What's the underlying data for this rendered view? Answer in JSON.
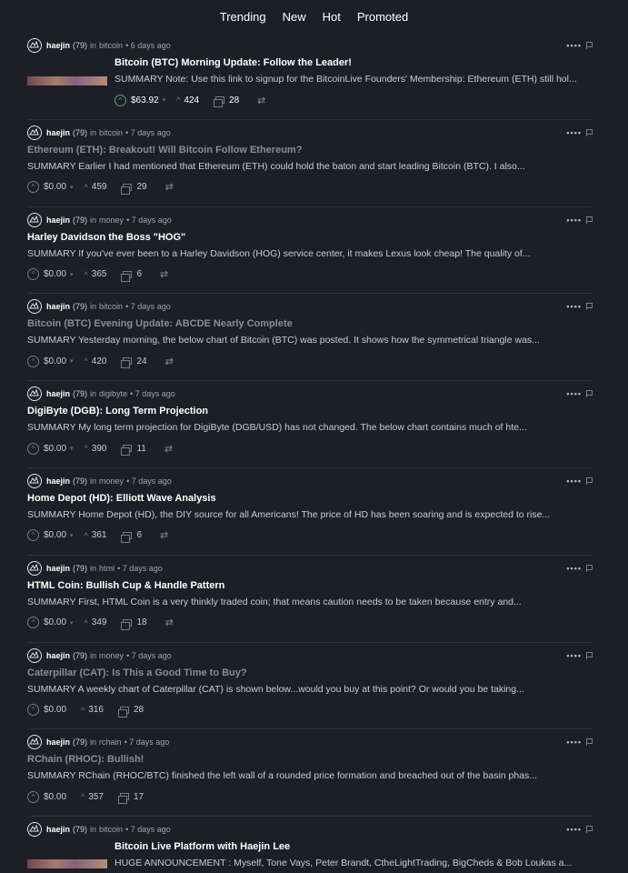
{
  "nav": {
    "tabs": [
      "Trending",
      "New",
      "Hot",
      "Promoted"
    ]
  },
  "posts": [
    {
      "author": "haejin",
      "rep": "(79)",
      "in": "in",
      "category": "bitcoin",
      "age": "• 6 days ago",
      "title": "Bitcoin (BTC) Morning Update: Follow the Leader!",
      "summary": "SUMMARY Note: Use this link to signup for the BitcoinLive Founders' Membership: Ethereum (ETH) still hol...",
      "payout": "$63.92",
      "votes": "424",
      "comments": "28",
      "muted_title": false
    },
    {
      "author": "haejin",
      "rep": "(79)",
      "in": "in",
      "category": "bitcoin",
      "age": "• 7 days ago",
      "title": "Ethereum (ETH): Breakout! Will Bitcoin Follow Ethereum?",
      "summary": "SUMMARY Earlier I had mentioned that Ethereum (ETH) could hold the baton and start leading Bitcoin (BTC). I also...",
      "payout": "$0.00",
      "votes": "459",
      "comments": "29",
      "muted_title": true
    },
    {
      "author": "haejin",
      "rep": "(79)",
      "in": "in",
      "category": "money",
      "age": "• 7 days ago",
      "title": "Harley Davidson the Boss \"HOG\"",
      "summary": "SUMMARY If you've ever been to a Harley Davidson (HOG) service center, it makes Lexus look cheap! The quality of...",
      "payout": "$0.00",
      "votes": "365",
      "comments": "6",
      "muted_title": false
    },
    {
      "author": "haejin",
      "rep": "(79)",
      "in": "in",
      "category": "bitcoin",
      "age": "• 7 days ago",
      "title": "Bitcoin (BTC) Evening Update: ABCDE Nearly Complete",
      "summary": "SUMMARY Yesterday morning, the below chart of Bitcoin (BTC) was posted. It shows how the symmetrical triangle was...",
      "payout": "$0.00",
      "votes": "420",
      "comments": "24",
      "muted_title": true
    },
    {
      "author": "haejin",
      "rep": "(79)",
      "in": "in",
      "category": "digibyte",
      "age": "• 7 days ago",
      "title": "DigiByte (DGB): Long Term Projection",
      "summary": "SUMMARY My long term projection for DigiByte (DGB/USD) has not changed. The below chart contains much of hte...",
      "payout": "$0.00",
      "votes": "390",
      "comments": "11",
      "muted_title": false
    },
    {
      "author": "haejin",
      "rep": "(79)",
      "in": "in",
      "category": "money",
      "age": "• 7 days ago",
      "title": "Home Depot (HD): Elliott Wave Analysis",
      "summary": "SUMMARY Home Depot (HD), the DIY source for all Americans! The price of HD has been soaring and is expected to rise...",
      "payout": "$0.00",
      "votes": "361",
      "comments": "6",
      "muted_title": false
    },
    {
      "author": "haejin",
      "rep": "(79)",
      "in": "in",
      "category": "html",
      "age": "• 7 days ago",
      "title": "HTML Coin: Bullish Cup & Handle Pattern",
      "summary": "SUMMARY First, HTML Coin is a very thinkly traded coin; that means caution needs to be taken because entry and...",
      "payout": "$0.00",
      "votes": "349",
      "comments": "18",
      "muted_title": false
    },
    {
      "author": "haejin",
      "rep": "(79)",
      "in": "in",
      "category": "money",
      "age": "• 7 days ago",
      "title": "Caterpillar (CAT): Is This a Good Time to Buy?",
      "summary": "SUMMARY A weekly chart of Caterpillar (CAT) is shown below...would you buy at this point? Or would you be taking...",
      "payout": "$0.00",
      "votes": "316",
      "comments": "28",
      "muted_title": true
    },
    {
      "author": "haejin",
      "rep": "(79)",
      "in": "in",
      "category": "rchain",
      "age": "• 7 days ago",
      "title": "RChain (RHOC): Bullish!",
      "summary": "SUMMARY RChain (RHOC/BTC) finished the left wall of a rounded price formation and breached out of the basin phas...",
      "payout": "$0.00",
      "votes": "357",
      "comments": "17",
      "muted_title": true
    },
    {
      "author": "haejin",
      "rep": "(79)",
      "in": "in",
      "category": "bitcoin",
      "age": "• 7 days ago",
      "title": "Bitcoin Live Platform with Haejin Lee",
      "summary": "HUGE ANNOUNCEMENT : Myself, Tone Vays, Peter Brandt, CtheLightTrading, BigCheds & Bob Loukas a...",
      "payout": "",
      "votes": "",
      "comments": "",
      "muted_title": false
    }
  ],
  "icons": {
    "avatar": "steem-avatar-icon",
    "upvote": "upvote-chevron-icon",
    "menu": "more-dots-icon",
    "flag": "flag-icon",
    "comments": "comments-icon",
    "resteem": "resteem-icon"
  },
  "colors": {
    "background": "#1d1f26",
    "accent_upvote": "#4ba57a",
    "divider": "#30333b"
  }
}
